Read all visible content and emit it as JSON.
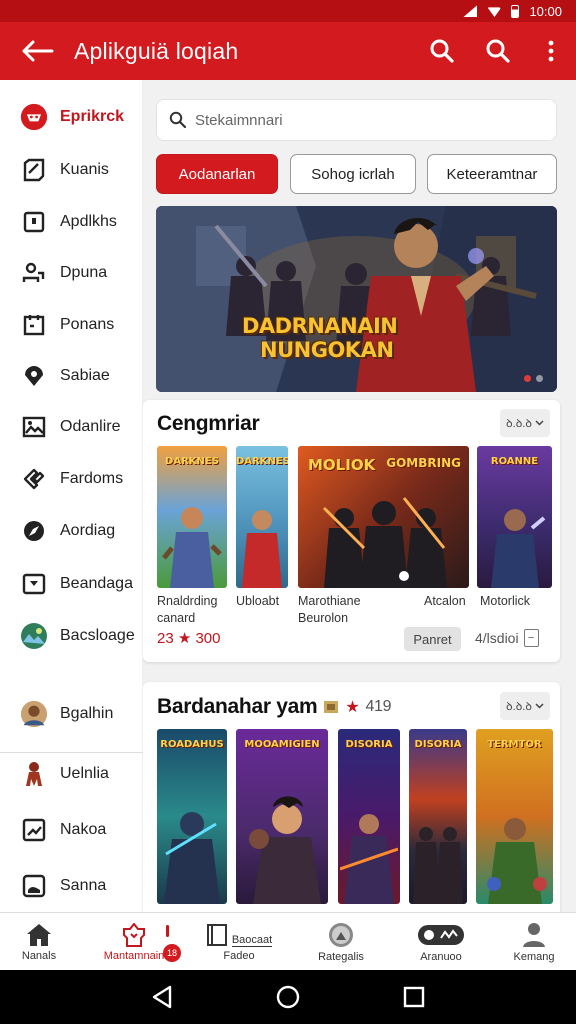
{
  "status_bar": {
    "time": "10:00"
  },
  "app_bar": {
    "title": "Aplikguiä loqiah",
    "back_icon": "arrow-left-icon",
    "actions": [
      "search-icon",
      "search-icon",
      "more-vert-icon"
    ]
  },
  "sidebar": {
    "items": [
      {
        "label": "Eprikrck",
        "icon": "brand-logo-icon"
      },
      {
        "label": "Kuanis",
        "icon": "check-square-icon"
      },
      {
        "label": "Apdlkhs",
        "icon": "square-icon"
      },
      {
        "label": "Dpuna",
        "icon": "people-icon"
      },
      {
        "label": "Ponans",
        "icon": "clipboard-icon"
      },
      {
        "label": "Sabiae",
        "icon": "pin-icon"
      },
      {
        "label": "Odanlire",
        "icon": "image-icon"
      },
      {
        "label": "Fardoms",
        "icon": "tag-icon"
      },
      {
        "label": "Aordiag",
        "icon": "compass-icon"
      },
      {
        "label": "Beandaga",
        "icon": "tv-icon"
      },
      {
        "label": "Bacsloage",
        "icon": "landscape-icon"
      },
      {
        "label": "Bgalhin",
        "icon": "avatar-icon"
      },
      {
        "label": "Uelnlia",
        "icon": "character-icon"
      },
      {
        "label": "Nakoa",
        "icon": "chart-icon"
      },
      {
        "label": "Sanna",
        "icon": "frame-icon"
      }
    ]
  },
  "search": {
    "placeholder": "Stekaimnnari"
  },
  "filters": [
    {
      "label": "Aodanarlan",
      "active": true
    },
    {
      "label": "Sohog icrlah",
      "active": false
    },
    {
      "label": "Keteeramtnar",
      "active": false
    }
  ],
  "hero": {
    "title_line1": "DADRNANAIN",
    "title_line2": "NUNGOKAN"
  },
  "section1": {
    "title": "Cengmriar",
    "more": "ꝺ.ꝺ.ꝺ",
    "games": [
      {
        "tile_text": "DARKNES",
        "name": "Rnaldrding\ncanard"
      },
      {
        "tile_text": "DARKNES",
        "name": "Ubloabt"
      },
      {
        "tile_text": "MOLIOK",
        "name": "Marothiane\nBeurolon"
      },
      {
        "tile_text": "GOMBRING",
        "name": "Atcalon"
      },
      {
        "tile_text": "ROANNE",
        "name": "Motorlick"
      }
    ],
    "price": "23 ★ 300",
    "get_label": "Panret",
    "count_label": "4/lsdioi",
    "count_box": "−"
  },
  "section2": {
    "title": "Bardanahar yam",
    "rating": "419",
    "more": "ꝺ.ꝺ.ꝺ",
    "tiles": [
      "ROADAHUS",
      "MOOAMIGIEN",
      "DISORIA",
      "DISORIA",
      "TERMTOR"
    ]
  },
  "bottom_nav": [
    {
      "label": "Nanals",
      "icon": "home-icon",
      "active": false
    },
    {
      "label": "Mantamnain",
      "icon": "game-icon",
      "active": true,
      "badge": "18"
    },
    {
      "label": "Fadeo",
      "icon": "book-icon",
      "active": false,
      "sub": "Baocaat"
    },
    {
      "label": "Rategalis",
      "icon": "face-icon",
      "active": false
    },
    {
      "label": "Aranuoo",
      "icon": "controller-icon",
      "active": false
    },
    {
      "label": "Kemang",
      "icon": "profile-icon",
      "active": false
    }
  ],
  "colors": {
    "brand": "#d31a1f",
    "brand_dark": "#b50f14",
    "background": "#f1f1f1"
  }
}
